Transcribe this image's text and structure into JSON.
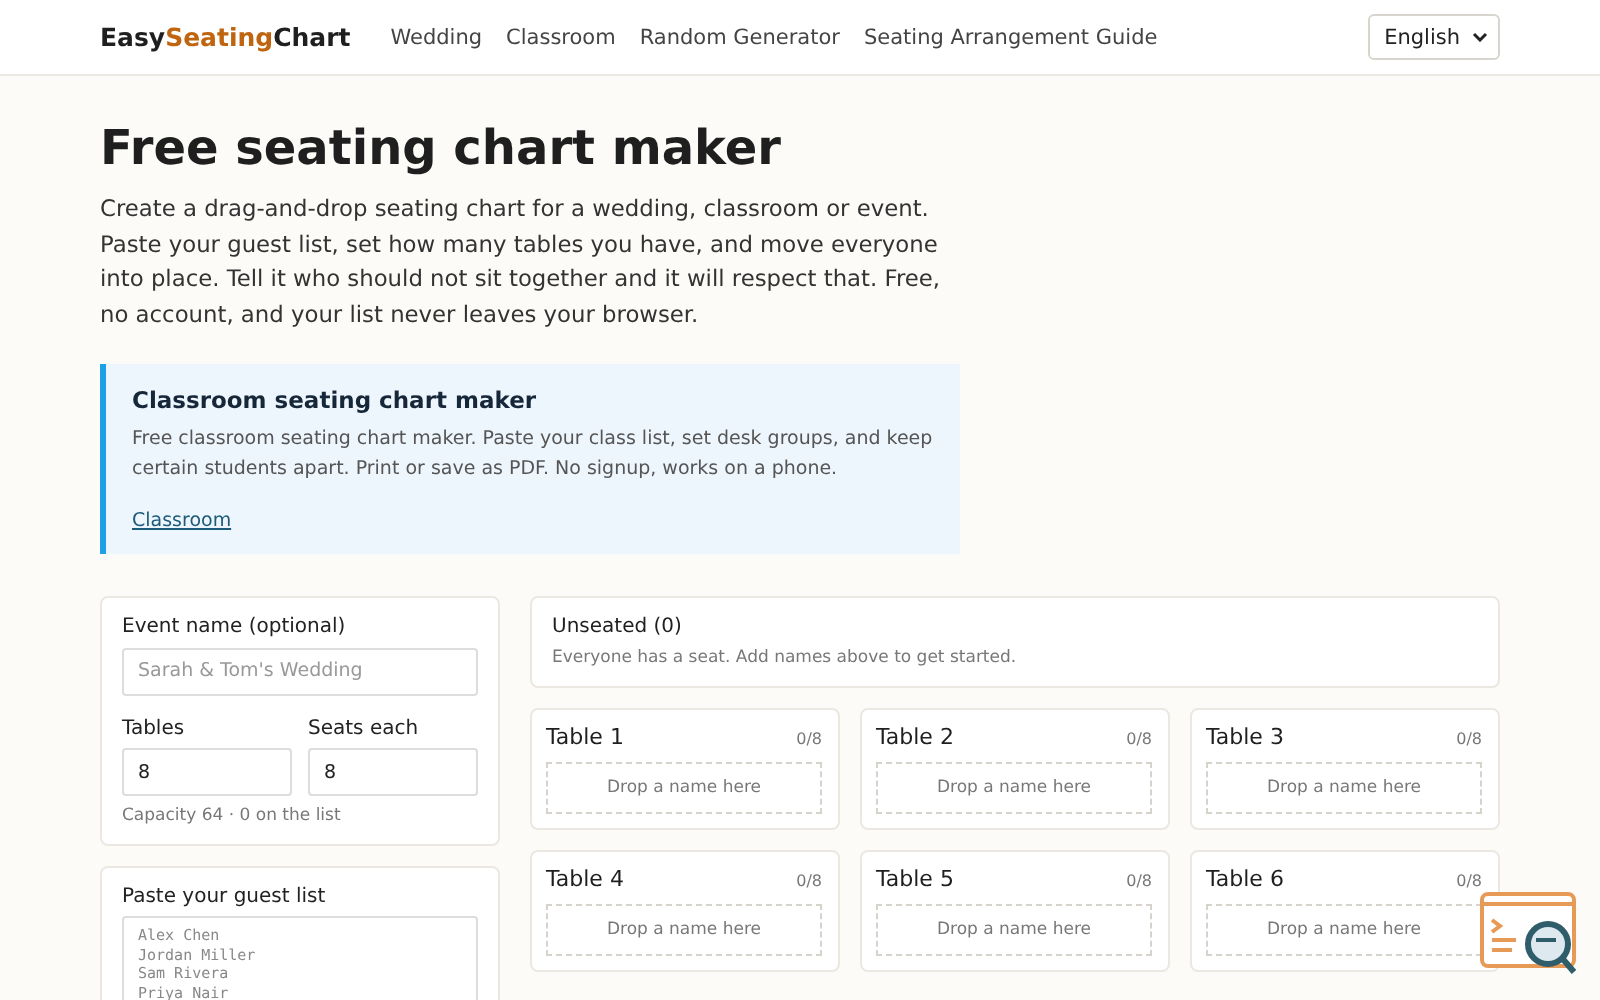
{
  "header": {
    "logo": [
      {
        "text": "Easy",
        "accent": false
      },
      {
        "text": "Seating",
        "accent": true
      },
      {
        "text": "Chart",
        "accent": false
      }
    ],
    "nav": [
      "Wedding",
      "Classroom",
      "Random Generator",
      "Seating Arrangement Guide"
    ],
    "language": "English"
  },
  "hero": {
    "title": "Free seating chart maker",
    "intro": "Create a drag-and-drop seating chart for a wedding, classroom or event. Paste your guest list, set how many tables you have, and move everyone into place. Tell it who should not sit together and it will respect that. Free, no account, and your list never leaves your browser."
  },
  "callout": {
    "title": "Classroom seating chart maker",
    "text": "Free classroom seating chart maker. Paste your class list, set desk groups, and keep certain students apart. Print or save as PDF. No signup, works on a phone.",
    "link": "Classroom"
  },
  "settings": {
    "event_label": "Event name (optional)",
    "event_placeholder": "Sarah & Tom's Wedding",
    "tables_label": "Tables",
    "tables_value": "8",
    "seats_label": "Seats each",
    "seats_value": "8",
    "capacity": "Capacity 64 · 0 on the list"
  },
  "guest_list": {
    "label": "Paste your guest list",
    "placeholder": "Alex Chen\nJordan Miller\nSam Rivera\nPriya Nair"
  },
  "unseated": {
    "title": "Unseated (0)",
    "text": "Everyone has a seat. Add names above to get started."
  },
  "tables": [
    {
      "name": "Table 1",
      "count": "0/8",
      "drop": "Drop a name here"
    },
    {
      "name": "Table 2",
      "count": "0/8",
      "drop": "Drop a name here"
    },
    {
      "name": "Table 3",
      "count": "0/8",
      "drop": "Drop a name here"
    },
    {
      "name": "Table 4",
      "count": "0/8",
      "drop": "Drop a name here"
    },
    {
      "name": "Table 5",
      "count": "0/8",
      "drop": "Drop a name here"
    },
    {
      "name": "Table 6",
      "count": "0/8",
      "drop": "Drop a name here"
    }
  ]
}
